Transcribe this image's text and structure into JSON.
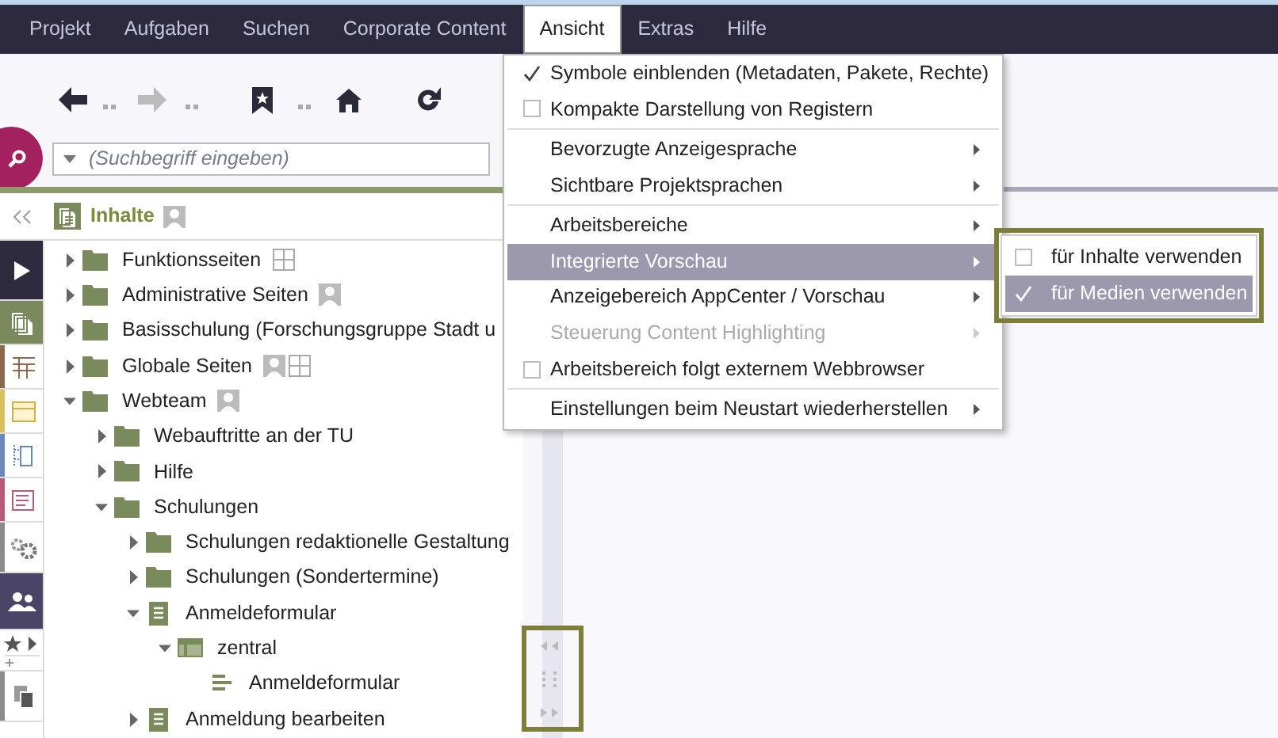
{
  "menubar": [
    {
      "label": "Projekt",
      "selected": false
    },
    {
      "label": "Aufgaben",
      "selected": false
    },
    {
      "label": "Suchen",
      "selected": false
    },
    {
      "label": "Corporate Content",
      "selected": false
    },
    {
      "label": "Ansicht",
      "selected": true
    },
    {
      "label": "Extras",
      "selected": false
    },
    {
      "label": "Hilfe",
      "selected": false
    }
  ],
  "search": {
    "placeholder": "(Suchbegriff eingeben)"
  },
  "panel": {
    "title": "Inhalte"
  },
  "sidebar": {
    "items": [
      {
        "kind": "expand",
        "selected": false
      },
      {
        "kind": "pages",
        "selected": true
      },
      {
        "kind": "table",
        "color": "#8a6a50",
        "selected": false
      },
      {
        "kind": "card",
        "color": "#d8c060",
        "selected": false
      },
      {
        "kind": "structure",
        "color": "#6a88b8",
        "selected": false
      },
      {
        "kind": "list",
        "color": "#b85a7a",
        "selected": false
      },
      {
        "kind": "gears",
        "color": "#8a8a8a",
        "selected": false
      },
      {
        "kind": "users",
        "selected": false
      },
      {
        "kind": "favorites",
        "selected": false
      },
      {
        "kind": "copy",
        "color": "#8a8a8a",
        "selected": false
      }
    ]
  },
  "tree": [
    {
      "label": "Funktionsseiten",
      "kind": "folder",
      "expanded": false,
      "badges": [
        {
          "kind": "grid"
        }
      ]
    },
    {
      "label": "Administrative Seiten",
      "kind": "folder",
      "expanded": false,
      "badges": [
        {
          "kind": "person"
        }
      ]
    },
    {
      "label": "Basisschulung (Forschungsgruppe Stadt u",
      "kind": "folder",
      "expanded": false
    },
    {
      "label": "Globale Seiten",
      "kind": "folder",
      "expanded": false,
      "badges": [
        {
          "kind": "person"
        },
        {
          "kind": "grid"
        }
      ]
    },
    {
      "label": "Webteam",
      "kind": "folder",
      "expanded": true,
      "badges": [
        {
          "kind": "person"
        }
      ],
      "children": [
        {
          "label": "Webauftritte an der TU",
          "kind": "folder",
          "expanded": false
        },
        {
          "label": "Hilfe",
          "kind": "folder",
          "expanded": false
        },
        {
          "label": "Schulungen",
          "kind": "folder",
          "expanded": true,
          "children": [
            {
              "label": "Schulungen redaktionelle Gestaltung",
              "kind": "folder",
              "expanded": false
            },
            {
              "label": "Schulungen (Sondertermine)",
              "kind": "folder",
              "expanded": false
            },
            {
              "label": "Anmeldeformular",
              "kind": "page",
              "expanded": true,
              "children": [
                {
                  "label": "zentral",
                  "kind": "table",
                  "expanded": true,
                  "children": [
                    {
                      "label": "Anmeldeformular",
                      "kind": "section"
                    }
                  ]
                }
              ]
            },
            {
              "label": "Anmeldung bearbeiten",
              "kind": "page",
              "expanded": false
            }
          ]
        }
      ]
    }
  ],
  "menu": {
    "items": [
      {
        "kind": "check",
        "label": "Symbole einblenden (Metadaten, Pakete, Rechte)",
        "checked": true,
        "selected": false,
        "disabled": false
      },
      {
        "kind": "check",
        "label": "Kompakte Darstellung von Registern",
        "checked": false,
        "selected": false,
        "disabled": false
      },
      {
        "kind": "separator"
      },
      {
        "kind": "submenu",
        "label": "Bevorzugte Anzeigesprache",
        "selected": false,
        "disabled": false
      },
      {
        "kind": "submenu",
        "label": "Sichtbare Projektsprachen",
        "selected": false,
        "disabled": false
      },
      {
        "kind": "separator"
      },
      {
        "kind": "submenu",
        "label": "Arbeitsbereiche",
        "selected": false,
        "disabled": false
      },
      {
        "kind": "submenu",
        "label": "Integrierte Vorschau",
        "selected": true,
        "disabled": false
      },
      {
        "kind": "submenu",
        "label": "Anzeigebereich AppCenter / Vorschau",
        "selected": false,
        "disabled": false
      },
      {
        "kind": "submenu",
        "label": "Steuerung Content Highlighting",
        "selected": false,
        "disabled": true
      },
      {
        "kind": "check",
        "label": "Arbeitsbereich folgt externem Webbrowser",
        "checked": false,
        "selected": false,
        "disabled": false
      },
      {
        "kind": "separator"
      },
      {
        "kind": "submenu",
        "label": "Einstellungen beim Neustart wiederherstellen",
        "selected": false,
        "disabled": false
      }
    ]
  },
  "submenu": {
    "items": [
      {
        "kind": "check",
        "label": "für Inhalte verwenden",
        "checked": false,
        "selected": false
      },
      {
        "kind": "check",
        "label": "für Medien verwenden",
        "checked": true,
        "selected": true
      }
    ]
  }
}
